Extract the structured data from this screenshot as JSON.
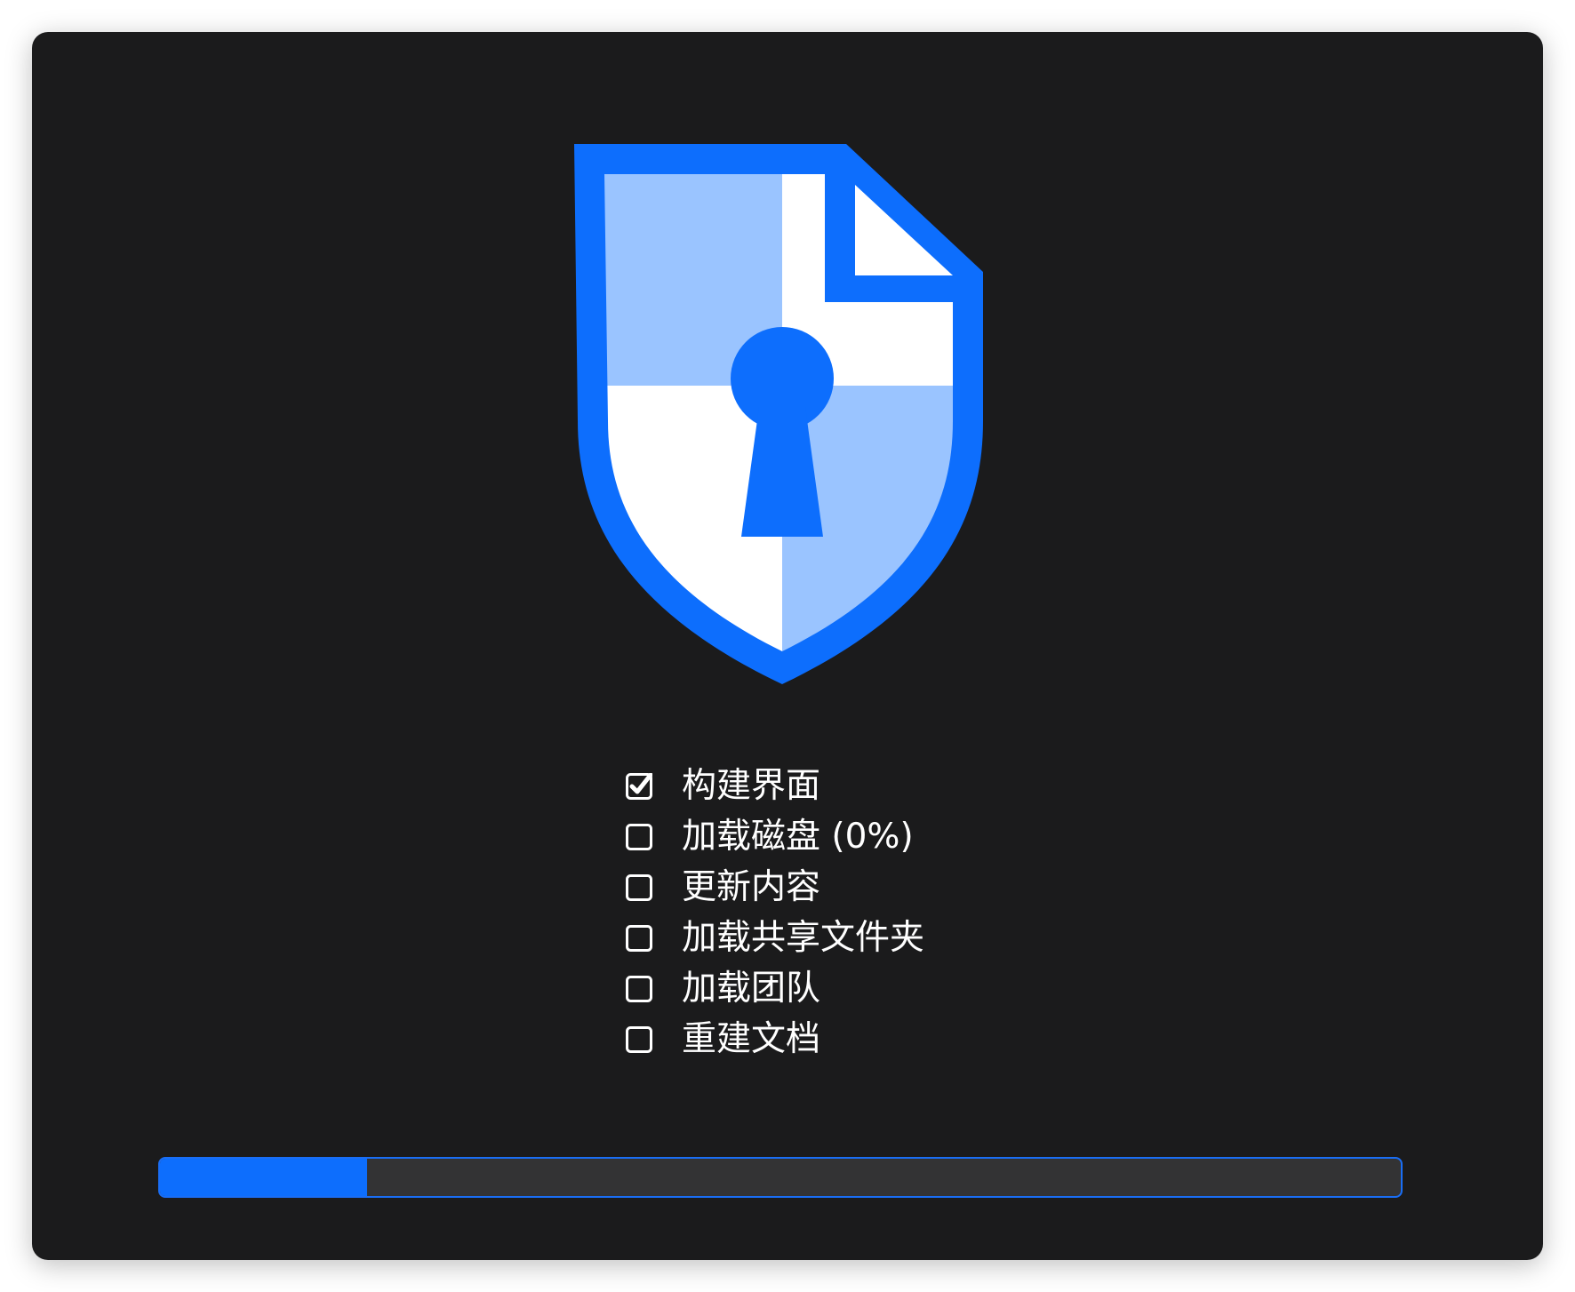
{
  "colors": {
    "background": "#1b1b1c",
    "accent": "#0d6efd",
    "shield_light": "#9ac4ff",
    "shield_white": "#ffffff",
    "progress_track": "#333334"
  },
  "logo": {
    "icon": "shield-keyhole-document-icon"
  },
  "steps": [
    {
      "label": "构建界面",
      "checked": true
    },
    {
      "label": "加载磁盘 (0%)",
      "checked": false
    },
    {
      "label": "更新内容",
      "checked": false
    },
    {
      "label": "加载共享文件夹",
      "checked": false
    },
    {
      "label": "加载团队",
      "checked": false
    },
    {
      "label": "重建文档",
      "checked": false
    }
  ],
  "progress": {
    "fraction": 0.167
  }
}
